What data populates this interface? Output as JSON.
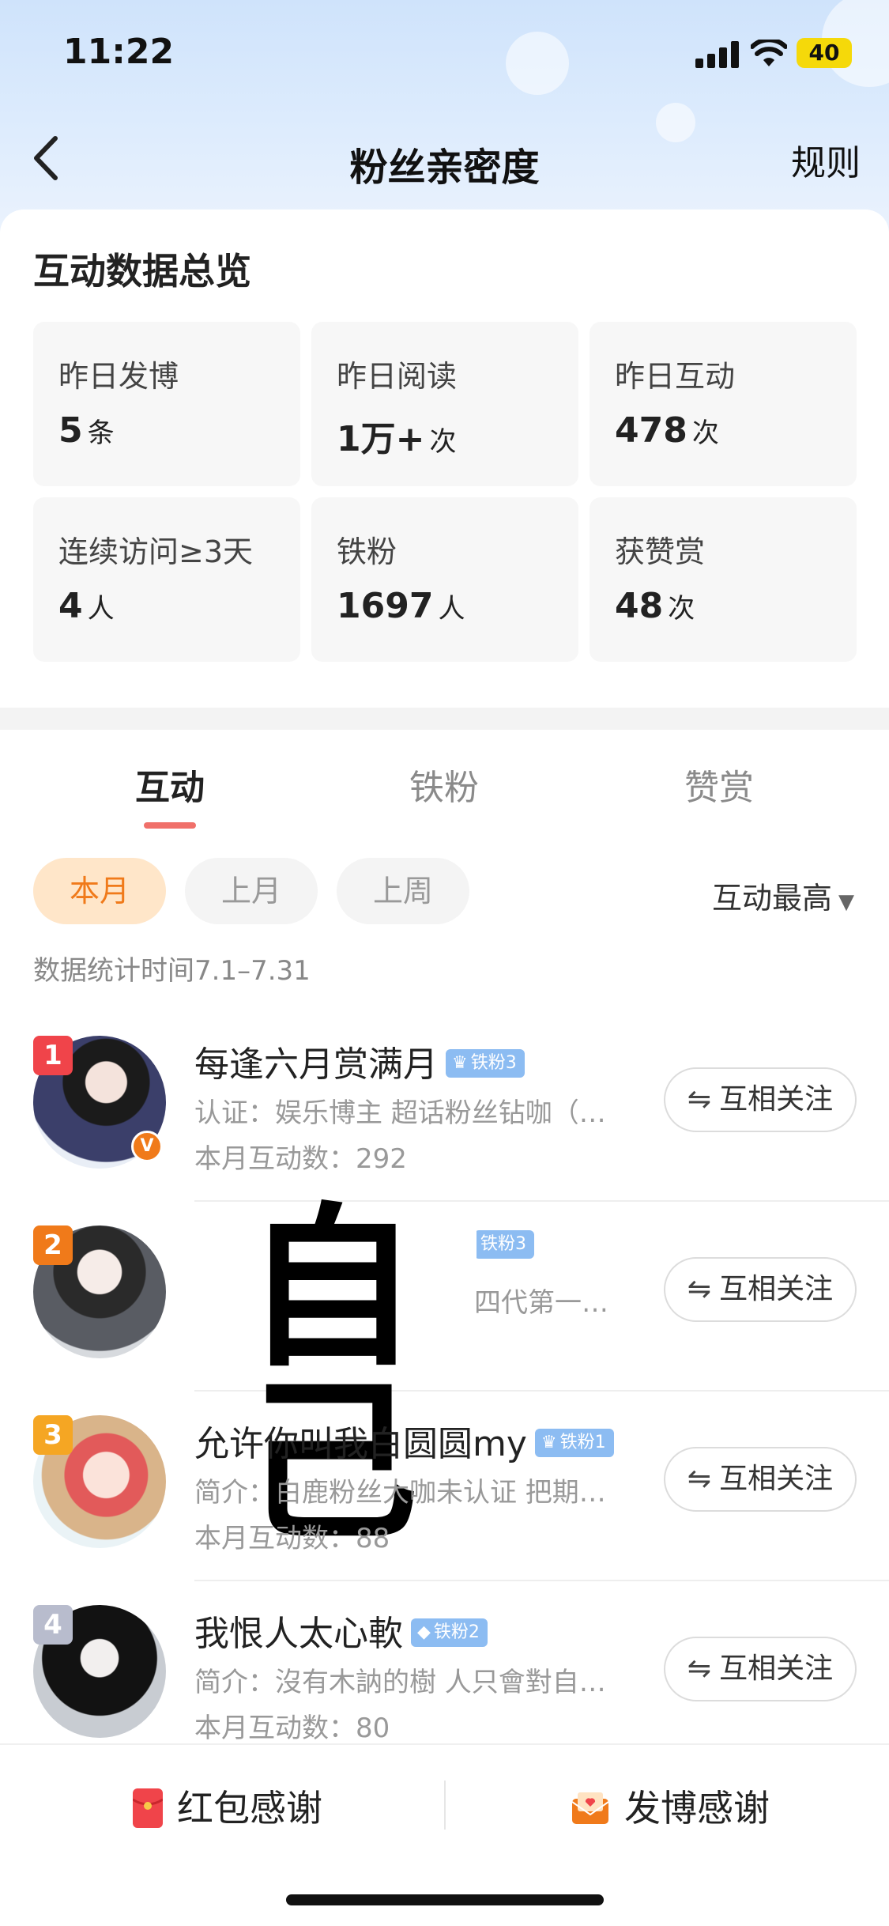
{
  "status_bar": {
    "time": "11:22",
    "battery": "40"
  },
  "nav": {
    "title": "粉丝亲密度",
    "rules": "规则"
  },
  "overview": {
    "title": "互动数据总览",
    "stats": [
      {
        "label": "昨日发博",
        "value": "5",
        "unit": "条"
      },
      {
        "label": "昨日阅读",
        "value": "1万+",
        "unit": "次"
      },
      {
        "label": "昨日互动",
        "value": "478",
        "unit": "次"
      },
      {
        "label": "连续访问≥3天",
        "value": "4",
        "unit": "人"
      },
      {
        "label": "铁粉",
        "value": "1697",
        "unit": "人"
      },
      {
        "label": "获赞赏",
        "value": "48",
        "unit": "次"
      }
    ]
  },
  "tabs": [
    {
      "label": "互动",
      "active": true
    },
    {
      "label": "铁粉",
      "active": false
    },
    {
      "label": "赞赏",
      "active": false
    }
  ],
  "filters": {
    "chips": [
      {
        "label": "本月",
        "active": true
      },
      {
        "label": "上月",
        "active": false
      },
      {
        "label": "上周",
        "active": false
      }
    ],
    "sort": "互动最高",
    "period": "数据统计时间7.1–7.31"
  },
  "fans": [
    {
      "rank": "1",
      "name": "每逢六月赏满月",
      "badge": "铁粉3",
      "desc": "认证：娱乐博主 超话粉丝钻咖（…",
      "count": "本月互动数：292",
      "follow": "互相关注",
      "rank_color": "#f0444a",
      "verified": true
    },
    {
      "rank": "2",
      "name": "",
      "badge": "铁粉3",
      "desc": "四代第一…",
      "count": "",
      "follow": "互相关注",
      "rank_color": "#f07a1a",
      "verified": false
    },
    {
      "rank": "3",
      "name": "允许你叫我白圆圆my",
      "badge": "铁粉1",
      "desc": "简介：白鹿粉丝大咖未认证 把期…",
      "count": "本月互动数：88",
      "follow": "互相关注",
      "rank_color": "#f5a623",
      "verified": false
    },
    {
      "rank": "4",
      "name": "我恨人太心軟",
      "badge": "铁粉2",
      "desc": "简介：沒有木訥的樹 人只會對自…",
      "count": "本月互动数：80",
      "follow": "互相关注",
      "rank_color": "#b8bccd",
      "verified": false
    }
  ],
  "censor_text": "自己",
  "bottom": {
    "red_packet": "红包感谢",
    "post_thanks": "发博感谢"
  },
  "colors": {
    "accent": "#f07a1a",
    "tab_underline": "#f0706a",
    "badge_blue": "#9fc6f5"
  }
}
